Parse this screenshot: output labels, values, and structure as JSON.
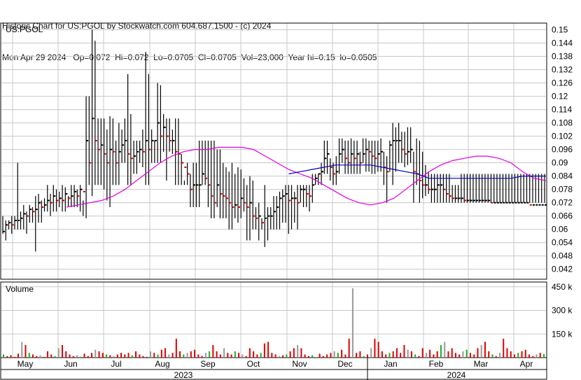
{
  "header": {
    "line1": "Historic Chart for US:PGOL by Stockwatch.com 604.687.1500 - (c) 2024",
    "line2": "Mon Apr 29 2024   Op=0.072  Hi=0.072  Lo=0.0705  Cl=0.0705  Vol=23,000  Year hi=0.15  lo=0.0505"
  },
  "colors": {
    "up": "#000000",
    "down": "#cc0000",
    "ma_short": "#e000e0",
    "ma_long": "#0000bb",
    "vol_up": "#22aa22",
    "vol_down": "#dd0000",
    "vol_flat": "#999999",
    "grid": "#c8c8c8"
  },
  "chart_data": [
    {
      "type": "ohlc",
      "title": "US:PGOL",
      "price_ticks": [
        "0.15",
        "0.144",
        "0.138",
        "0.132",
        "0.126",
        "0.12",
        "0.114",
        "0.108",
        "0.102",
        "0.096",
        "0.09",
        "0.084",
        "0.078",
        "0.072",
        "0.066",
        "0.06",
        "0.054",
        "0.048",
        "0.042"
      ],
      "ylim": [
        0.0375,
        0.153
      ],
      "months": [
        "May",
        "Jun",
        "Jul",
        "Aug",
        "Sep",
        "Oct",
        "Nov",
        "Dec",
        "Jan",
        "Feb",
        "Mar",
        "Apr"
      ],
      "years": [
        "2023",
        "2024"
      ],
      "series": [
        {
          "name": "price",
          "x": [
            0,
            2,
            4,
            6,
            8,
            10,
            12,
            14,
            16,
            18,
            20,
            22,
            24,
            26,
            28,
            30,
            32,
            34,
            36,
            38,
            40,
            42,
            44,
            46,
            48,
            50,
            52,
            54,
            56,
            58,
            60,
            62,
            64,
            66,
            68,
            70,
            72,
            74,
            76,
            78,
            80,
            82,
            84,
            86,
            88,
            90,
            92,
            94,
            96,
            98,
            100,
            102,
            104,
            106,
            108,
            110,
            112,
            114,
            116,
            118,
            120,
            122,
            124,
            126,
            128,
            130,
            132,
            134,
            136,
            138,
            140,
            142,
            144,
            146,
            148,
            150,
            152,
            154,
            156,
            158,
            160,
            162,
            164,
            166,
            168,
            170,
            172,
            174,
            176,
            178,
            180,
            182,
            184,
            186,
            188,
            190,
            192,
            194,
            196,
            198,
            200,
            202,
            204,
            206,
            208,
            210,
            212,
            214,
            216,
            218,
            220,
            222,
            224,
            226,
            228,
            230,
            232,
            234,
            236,
            238,
            240,
            242,
            244,
            246,
            248,
            250,
            252,
            254,
            256,
            258,
            260,
            262,
            264,
            266,
            268,
            270,
            272,
            274,
            276,
            278,
            280,
            282,
            284,
            286,
            288,
            290,
            292,
            294,
            296,
            298,
            300,
            302,
            304,
            306,
            308,
            310,
            312,
            314,
            316,
            318,
            320,
            322,
            324,
            326,
            328,
            330,
            332,
            334,
            336,
            338,
            340,
            342,
            344,
            346,
            348,
            350,
            352,
            354,
            356,
            358,
            360,
            362,
            364
          ],
          "high": [
            0.066,
            0.064,
            0.064,
            0.066,
            0.066,
            0.09,
            0.068,
            0.071,
            0.068,
            0.071,
            0.07,
            0.075,
            0.076,
            0.073,
            0.074,
            0.08,
            0.076,
            0.08,
            0.078,
            0.077,
            0.08,
            0.079,
            0.075,
            0.08,
            0.08,
            0.078,
            0.08,
            0.073,
            0.12,
            0.12,
            0.15,
            0.145,
            0.11,
            0.11,
            0.11,
            0.105,
            0.111,
            0.11,
            0.1,
            0.108,
            0.105,
            0.11,
            0.13,
            0.112,
            0.1,
            0.1,
            0.1,
            0.105,
            0.14,
            0.13,
            0.105,
            0.1,
            0.126,
            0.125,
            0.112,
            0.11,
            0.11,
            0.105,
            0.11,
            0.11,
            0.094,
            0.082,
            0.09,
            0.085,
            0.09,
            0.09,
            0.1,
            0.1,
            0.1,
            0.1,
            0.1,
            0.1,
            0.096,
            0.096,
            0.09,
            0.088,
            0.086,
            0.09,
            0.085,
            0.088,
            0.087,
            0.083,
            0.08,
            0.084,
            0.082,
            0.07,
            0.072,
            0.065,
            0.08,
            0.07,
            0.07,
            0.075,
            0.075,
            0.077,
            0.078,
            0.08,
            0.08,
            0.08,
            0.077,
            0.08,
            0.08,
            0.08,
            0.08,
            0.08,
            0.085,
            0.085,
            0.085,
            0.09,
            0.1,
            0.1,
            0.092,
            0.09,
            0.093,
            0.101,
            0.101,
            0.1,
            0.1,
            0.101,
            0.1,
            0.1,
            0.095,
            0.101,
            0.101,
            0.1,
            0.1,
            0.1,
            0.1,
            0.101,
            0.095,
            0.093,
            0.1,
            0.108,
            0.106,
            0.108,
            0.104,
            0.104,
            0.106,
            0.106,
            0.095,
            0.101,
            0.1,
            0.095,
            0.089,
            0.086,
            0.085,
            0.085,
            0.085,
            0.085,
            0.085,
            0.085,
            0.085,
            0.08,
            0.08,
            0.08,
            0.085,
            0.085,
            0.085,
            0.085,
            0.085,
            0.085,
            0.085,
            0.085,
            0.085,
            0.085,
            0.085,
            0.085,
            0.085,
            0.085,
            0.085,
            0.085,
            0.085,
            0.085,
            0.085,
            0.085,
            0.085,
            0.085,
            0.085,
            0.085,
            0.085,
            0.085,
            0.085,
            0.085,
            0.085,
            0.085,
            0.085,
            0.085,
            0.085
          ],
          "low": [
            0.058,
            0.055,
            0.06,
            0.058,
            0.06,
            0.06,
            0.06,
            0.06,
            0.058,
            0.063,
            0.063,
            0.05,
            0.063,
            0.063,
            0.068,
            0.068,
            0.066,
            0.068,
            0.068,
            0.07,
            0.068,
            0.068,
            0.07,
            0.07,
            0.07,
            0.07,
            0.068,
            0.066,
            0.065,
            0.08,
            0.075,
            0.08,
            0.08,
            0.08,
            0.078,
            0.073,
            0.07,
            0.08,
            0.08,
            0.08,
            0.09,
            0.09,
            0.08,
            0.08,
            0.085,
            0.085,
            0.09,
            0.088,
            0.08,
            0.08,
            0.09,
            0.09,
            0.09,
            0.09,
            0.095,
            0.082,
            0.095,
            0.094,
            0.08,
            0.08,
            0.08,
            0.08,
            0.08,
            0.07,
            0.07,
            0.07,
            0.07,
            0.08,
            0.08,
            0.07,
            0.065,
            0.065,
            0.07,
            0.065,
            0.065,
            0.065,
            0.06,
            0.06,
            0.065,
            0.063,
            0.065,
            0.068,
            0.055,
            0.055,
            0.06,
            0.06,
            0.055,
            0.06,
            0.052,
            0.055,
            0.06,
            0.06,
            0.06,
            0.06,
            0.063,
            0.063,
            0.058,
            0.06,
            0.063,
            0.06,
            0.072,
            0.07,
            0.07,
            0.068,
            0.072,
            0.08,
            0.08,
            0.08,
            0.085,
            0.085,
            0.082,
            0.08,
            0.08,
            0.085,
            0.09,
            0.085,
            0.085,
            0.085,
            0.085,
            0.085,
            0.085,
            0.09,
            0.086,
            0.086,
            0.085,
            0.085,
            0.086,
            0.086,
            0.08,
            0.072,
            0.086,
            0.08,
            0.086,
            0.09,
            0.09,
            0.088,
            0.089,
            0.09,
            0.072,
            0.08,
            0.072,
            0.074,
            0.075,
            0.076,
            0.072,
            0.072,
            0.072,
            0.072,
            0.072,
            0.072,
            0.072,
            0.072,
            0.072,
            0.072,
            0.072,
            0.072,
            0.072,
            0.072,
            0.072,
            0.072,
            0.072,
            0.072,
            0.072,
            0.072,
            0.072,
            0.072,
            0.072,
            0.072,
            0.072,
            0.072,
            0.072,
            0.072,
            0.072,
            0.072,
            0.072,
            0.072,
            0.072,
            0.072,
            0.072,
            0.072,
            0.072,
            0.072,
            0.072,
            0.072,
            0.072,
            0.072,
            0.072
          ],
          "close": [
            0.059,
            0.062,
            0.063,
            0.062,
            0.064,
            0.064,
            0.065,
            0.067,
            0.066,
            0.069,
            0.068,
            0.069,
            0.072,
            0.07,
            0.071,
            0.073,
            0.072,
            0.075,
            0.073,
            0.074,
            0.073,
            0.076,
            0.074,
            0.075,
            0.077,
            0.075,
            0.078,
            0.077,
            0.1,
            0.09,
            0.11,
            0.1,
            0.096,
            0.098,
            0.094,
            0.09,
            0.096,
            0.095,
            0.09,
            0.095,
            0.098,
            0.1,
            0.094,
            0.092,
            0.093,
            0.095,
            0.096,
            0.095,
            0.1,
            0.096,
            0.1,
            0.1,
            0.108,
            0.102,
            0.106,
            0.102,
            0.1,
            0.1,
            0.095,
            0.094,
            0.09,
            0.088,
            0.085,
            0.078,
            0.08,
            0.08,
            0.08,
            0.085,
            0.083,
            0.08,
            0.075,
            0.072,
            0.08,
            0.076,
            0.075,
            0.074,
            0.072,
            0.07,
            0.071,
            0.07,
            0.074,
            0.072,
            0.07,
            0.072,
            0.066,
            0.065,
            0.066,
            0.063,
            0.065,
            0.066,
            0.066,
            0.068,
            0.07,
            0.074,
            0.075,
            0.076,
            0.073,
            0.074,
            0.074,
            0.072,
            0.078,
            0.078,
            0.076,
            0.075,
            0.08,
            0.083,
            0.085,
            0.086,
            0.092,
            0.094,
            0.088,
            0.085,
            0.086,
            0.094,
            0.096,
            0.092,
            0.09,
            0.094,
            0.092,
            0.094,
            0.09,
            0.094,
            0.096,
            0.095,
            0.093,
            0.092,
            0.094,
            0.095,
            0.088,
            0.086,
            0.098,
            0.1,
            0.1,
            0.1,
            0.096,
            0.094,
            0.095,
            0.096,
            0.086,
            0.085,
            0.082,
            0.08,
            0.08,
            0.078,
            0.078,
            0.078,
            0.08,
            0.08,
            0.078,
            0.076,
            0.075,
            0.074,
            0.074,
            0.074,
            0.074,
            0.073,
            0.073,
            0.073,
            0.073,
            0.073,
            0.073,
            0.073,
            0.073,
            0.073,
            0.072,
            0.072,
            0.072,
            0.072,
            0.072,
            0.072,
            0.072,
            0.072,
            0.072,
            0.072,
            0.072,
            0.072,
            0.072,
            0.071,
            0.071,
            0.071,
            0.071,
            0.071,
            0.071,
            0.071,
            0.071,
            0.0705,
            0.0705
          ]
        }
      ],
      "ma_short": [
        0.07,
        0.071,
        0.072,
        0.073,
        0.075,
        0.078,
        0.082,
        0.086,
        0.09,
        0.093,
        0.095,
        0.096,
        0.096,
        0.097,
        0.097,
        0.097,
        0.096,
        0.093,
        0.09,
        0.087,
        0.085,
        0.083,
        0.08,
        0.077,
        0.074,
        0.072,
        0.071,
        0.072,
        0.074,
        0.078,
        0.082,
        0.086,
        0.089,
        0.091,
        0.092,
        0.093,
        0.093,
        0.092,
        0.09,
        0.086,
        0.083,
        0.082
      ],
      "ma_long": [
        null,
        null,
        null,
        null,
        null,
        null,
        null,
        null,
        null,
        null,
        null,
        null,
        null,
        null,
        null,
        null,
        null,
        null,
        null,
        0.085,
        0.086,
        0.087,
        0.088,
        0.089,
        0.089,
        0.089,
        0.089,
        0.088,
        0.087,
        0.086,
        0.085,
        0.083,
        0.083,
        0.083,
        0.083,
        0.083,
        0.083,
        0.083,
        0.083,
        0.084,
        0.084,
        0.084
      ]
    },
    {
      "type": "bar",
      "title": "Volume",
      "vol_ticks": [
        "450 k",
        "300 k",
        "150 k"
      ],
      "ylim": [
        0,
        480000
      ],
      "values": [
        20,
        10,
        15,
        5,
        25,
        100,
        80,
        30,
        20,
        10,
        15,
        5,
        40,
        20,
        10,
        60,
        80,
        40,
        20,
        10,
        15,
        5,
        25,
        10,
        30,
        50,
        40,
        30,
        20,
        15,
        10,
        20,
        30,
        20,
        30,
        15,
        40,
        20,
        10,
        5,
        40,
        30,
        20,
        50,
        60,
        20,
        30,
        120,
        40,
        20,
        30,
        40,
        50,
        20,
        10,
        30,
        40,
        80,
        40,
        20,
        60,
        30,
        20,
        40,
        30,
        20,
        10,
        60,
        40,
        20,
        30,
        90,
        100,
        30,
        20,
        10,
        15,
        20,
        40,
        60,
        80,
        60,
        20,
        10,
        15,
        5,
        25,
        10,
        20,
        30,
        40,
        30,
        50,
        20,
        120,
        440,
        30,
        40,
        10,
        20,
        60,
        120,
        100,
        40,
        20,
        30,
        40,
        60,
        30,
        80,
        50,
        40,
        20,
        10,
        60,
        30,
        50,
        20,
        40,
        80,
        100,
        40,
        60,
        30,
        20,
        40,
        50,
        30,
        20,
        60,
        80,
        100,
        40,
        20,
        10,
        30,
        120,
        60,
        40,
        20,
        30,
        40,
        50,
        20,
        10,
        20,
        30,
        23
      ]
    }
  ]
}
